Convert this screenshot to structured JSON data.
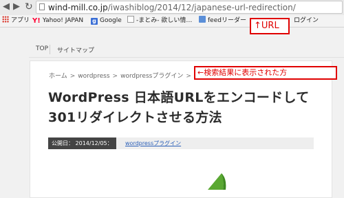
{
  "browser": {
    "url_host": "wind-mill.co.jp",
    "url_path": "/iwashiblog/2014/12/japanese-url-redirection/",
    "bookmarks": [
      {
        "label": "アプリ",
        "icon": "apps-icon"
      },
      {
        "label": "Yahoo! JAPAN",
        "icon": "yahoo-icon"
      },
      {
        "label": "Google",
        "icon": "google-icon"
      },
      {
        "label": "-まとみ- 欲しい情…",
        "icon": "matome-icon"
      },
      {
        "label": "feedリーダー",
        "icon": "feed-icon"
      },
      {
        "label": "ログイン",
        "icon": "none"
      }
    ]
  },
  "site_nav": {
    "items": [
      "TOP",
      "サイトマップ"
    ]
  },
  "article": {
    "breadcrumb": [
      "ホーム",
      "wordpress",
      "wordpressプラグイン"
    ],
    "breadcrumb_separator": ">",
    "title": "WordPress 日本語URLをエンコードして301リダイレクトさせる方法",
    "published_label": "公開日： 2014/12/05：",
    "category": "wordpressプラグイン"
  },
  "annotations": {
    "url_callout": "↑URL",
    "search_callout": "←検索結果に表示された方"
  },
  "colors": {
    "annotation_red": "#e00000",
    "meta_dark": "#444444",
    "link_blue": "#2b5fb8",
    "leaf_green": "#5aa832"
  }
}
